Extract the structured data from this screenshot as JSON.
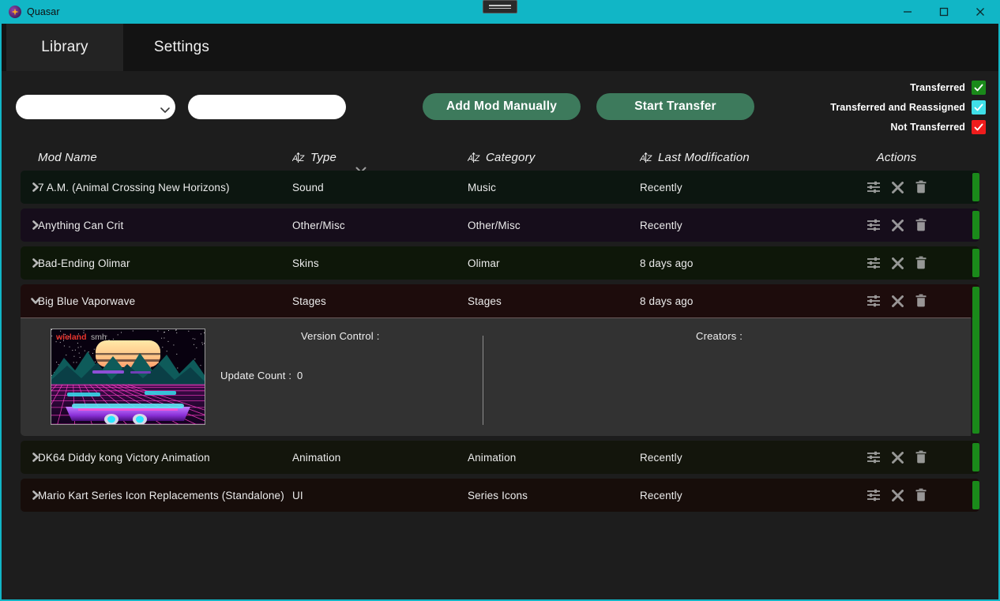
{
  "window": {
    "title": "Quasar",
    "app_icon": "quasar-star-icon",
    "controls": {
      "minimize": "minimize-icon",
      "maximize": "maximize-icon",
      "close": "close-icon"
    },
    "snap_handle": "window-snap-handle",
    "titlebar_color": "#11b6c6"
  },
  "tabs": [
    {
      "label": "Library",
      "active": true
    },
    {
      "label": "Settings",
      "active": false
    }
  ],
  "toolbar": {
    "filter_select": {
      "value": "",
      "placeholder": "",
      "options": [
        ""
      ]
    },
    "search": {
      "value": "",
      "placeholder": ""
    },
    "clear_search_icon": "clear-x-icon",
    "add_mod_label": "Add Mod Manually",
    "start_transfer_label": "Start Transfer",
    "button_color": "#3d7a5c"
  },
  "legend": [
    {
      "label": "Transferred",
      "color": "#1a8a1a",
      "checked": true
    },
    {
      "label": "Transferred and Reassigned",
      "color": "#3fe0e8",
      "checked": true
    },
    {
      "label": "Not Transferred",
      "color": "#ef1c1c",
      "checked": true
    }
  ],
  "table": {
    "columns": [
      {
        "label": "Mod Name",
        "sortable": false
      },
      {
        "label": "Type",
        "sortable": true
      },
      {
        "label": "Category",
        "sortable": true
      },
      {
        "label": "Last Modification",
        "sortable": true
      },
      {
        "label": "Actions",
        "sortable": false
      }
    ],
    "row_actions": [
      {
        "name": "configure-icon",
        "title": "Configure"
      },
      {
        "name": "disable-x-icon",
        "title": "Disable"
      },
      {
        "name": "delete-trash-icon",
        "title": "Delete"
      }
    ],
    "rows": [
      {
        "name": "7 A.M. (Animal Crossing New Horizons)",
        "type": "Sound",
        "category": "Music",
        "modified": "Recently",
        "expanded": false,
        "tint": "#0c1610",
        "status_color": "#1a8a1a"
      },
      {
        "name": "Anything Can Crit",
        "type": "Other/Misc",
        "category": "Other/Misc",
        "modified": "Recently",
        "expanded": false,
        "tint": "#160d1b",
        "status_color": "#1a8a1a"
      },
      {
        "name": "Bad-Ending Olimar",
        "type": "Skins",
        "category": "Olimar",
        "modified": "8 days ago",
        "expanded": false,
        "tint": "#0e1709",
        "status_color": "#1a8a1a"
      },
      {
        "name": "Big Blue Vaporwave",
        "type": "Stages",
        "category": "Stages",
        "modified": "8 days ago",
        "expanded": true,
        "tint": "#1d0c0c",
        "status_color": "#1a8a1a",
        "detail": {
          "thumbnail_alt": "Big Blue Vaporwave stage preview",
          "thumbnail_watermark": "wieland smh",
          "version_control_label": "Version Control :",
          "update_count_label": "Update Count :",
          "update_count_value": "0",
          "creators_label": "Creators :"
        }
      },
      {
        "name": "DK64 Diddy kong Victory Animation",
        "type": "Animation",
        "category": "Animation",
        "modified": "Recently",
        "expanded": false,
        "tint": "#13150c",
        "status_color": "#1a8a1a"
      },
      {
        "name": "Mario Kart Series Icon Replacements (Standalone)",
        "type": "UI",
        "category": "Series Icons",
        "modified": "Recently",
        "expanded": false,
        "tint": "#170d0a",
        "status_color": "#1a8a1a"
      }
    ]
  }
}
